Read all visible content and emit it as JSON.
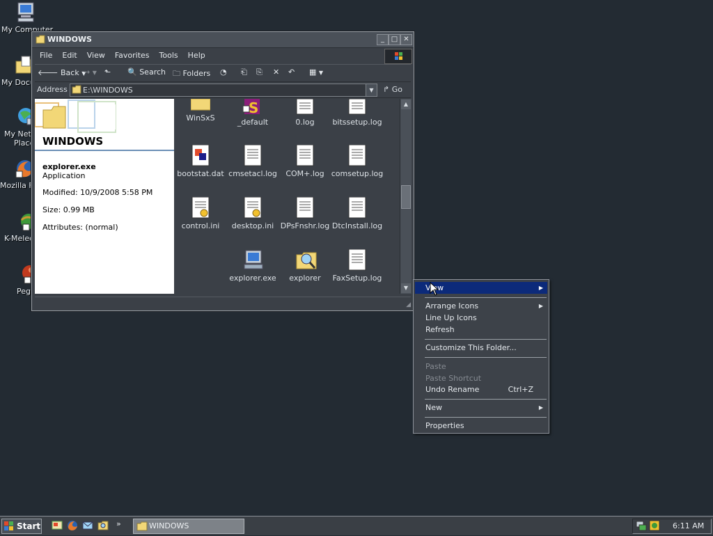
{
  "desktop": {
    "icons": [
      {
        "label": "My Computer",
        "icon": "computer-icon"
      },
      {
        "label": "My Docu",
        "icon": "folder-documents-icon"
      },
      {
        "label": "My Netw",
        "label2": "Place",
        "icon": "network-icon"
      },
      {
        "label": "Mozilla Fi",
        "icon": "firefox-icon"
      },
      {
        "label": "K-Melec",
        "icon": "k-meleon-icon"
      },
      {
        "label": "Pegi",
        "icon": "pegasus-icon"
      }
    ]
  },
  "window": {
    "title": "WINDOWS",
    "menu": [
      "File",
      "Edit",
      "View",
      "Favorites",
      "Tools",
      "Help"
    ],
    "toolbar": {
      "back": "Back",
      "search": "Search",
      "folders": "Folders"
    },
    "address": {
      "label": "Address",
      "value": "E:\\WINDOWS",
      "go": "Go"
    },
    "details": {
      "folder_title": "WINDOWS",
      "name": "explorer.exe",
      "type": "Application",
      "modified": "Modified: 10/9/2008 5:58 PM",
      "size": "Size: 0.99 MB",
      "attributes": "Attributes: (normal)"
    },
    "files": [
      {
        "label": "WinSxS",
        "icon": "folder-icon"
      },
      {
        "label": "_default",
        "icon": "media-file-icon"
      },
      {
        "label": "0.log",
        "icon": "text-file-icon"
      },
      {
        "label": "bitssetup.log",
        "icon": "text-file-icon"
      },
      {
        "label": "bootstat.dat",
        "icon": "dat-file-icon"
      },
      {
        "label": "cmsetacl.log",
        "icon": "text-file-icon"
      },
      {
        "label": "COM+.log",
        "icon": "text-file-icon"
      },
      {
        "label": "comsetup.log",
        "icon": "text-file-icon"
      },
      {
        "label": "control.ini",
        "icon": "ini-file-icon"
      },
      {
        "label": "desktop.ini",
        "icon": "ini-file-icon"
      },
      {
        "label": "DPsFnshr.log",
        "icon": "text-file-icon"
      },
      {
        "label": "DtcInstall.log",
        "icon": "text-file-icon"
      },
      {
        "label": "explorer.exe",
        "icon": "exe-icon"
      },
      {
        "label": "explorer",
        "icon": "search-shortcut-icon"
      },
      {
        "label": "FaxSetup.log",
        "icon": "text-file-icon"
      }
    ]
  },
  "context_menu": {
    "items": {
      "view": "View",
      "arrange_icons": "Arrange Icons",
      "line_up_icons": "Line Up Icons",
      "refresh": "Refresh",
      "customize": "Customize This Folder...",
      "paste": "Paste",
      "paste_shortcut": "Paste Shortcut",
      "undo_rename": "Undo Rename",
      "undo_shortcut": "Ctrl+Z",
      "new": "New",
      "properties": "Properties"
    }
  },
  "taskbar": {
    "start": "Start",
    "task": "WINDOWS",
    "clock": "6:11 AM"
  },
  "colors": {
    "desktop": "#232b33",
    "menu_highlight": "#0c2a7a",
    "window_bg": "#3b4047"
  }
}
